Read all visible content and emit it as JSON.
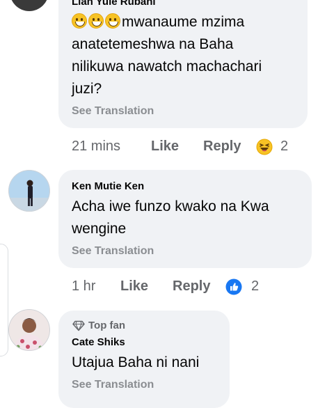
{
  "comments": [
    {
      "author": "Lian Yule Rubani",
      "text_line1": "mwanaume mzima",
      "text_line2": "anatetemeshwa na Baha",
      "text_line3": "nilikuwa nawatch machachari",
      "text_line4": "juzi?",
      "see_translation": "See Translation",
      "time": "21 mins",
      "like": "Like",
      "reply": "Reply",
      "reaction_icon": "haha-reaction-icon",
      "reaction_count": "2"
    },
    {
      "author": "Ken Mutie Ken",
      "text_line1": "Acha iwe funzo kwako na Kwa",
      "text_line2": "wengine",
      "see_translation": "See Translation",
      "time": "1 hr",
      "like": "Like",
      "reply": "Reply",
      "reaction_icon": "like-reaction-icon",
      "reaction_count": "2"
    },
    {
      "badge": "Top fan",
      "badge_icon": "diamond-icon",
      "author": "Cate Shiks",
      "text_line1": "Utajua Baha ni nani",
      "see_translation": "See Translation"
    }
  ],
  "colors": {
    "bubble": "#f0f2f5",
    "muted": "#65676b",
    "like_blue": "#1877f2",
    "haha_yellow": "#f7c325"
  }
}
